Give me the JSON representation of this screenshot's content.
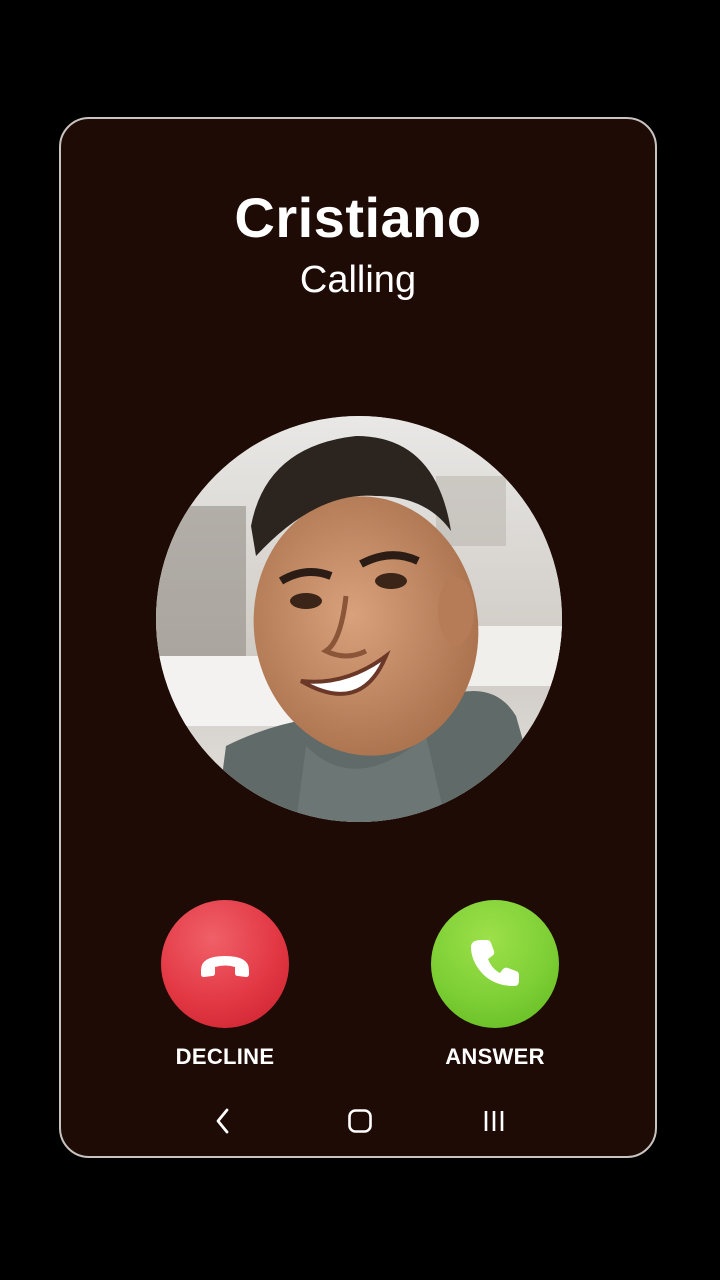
{
  "caller": {
    "name": "Cristiano",
    "status": "Calling"
  },
  "actions": {
    "decline_label": "DECLINE",
    "answer_label": "ANSWER"
  },
  "colors": {
    "background": "#1e0b05",
    "decline": "#e23844",
    "answer": "#7dcf35",
    "text": "#ffffff"
  },
  "icons": {
    "decline": "phone-hangup-icon",
    "answer": "phone-icon",
    "nav_back": "chevron-left-icon",
    "nav_home": "home-square-icon",
    "nav_recent": "recent-apps-icon"
  }
}
